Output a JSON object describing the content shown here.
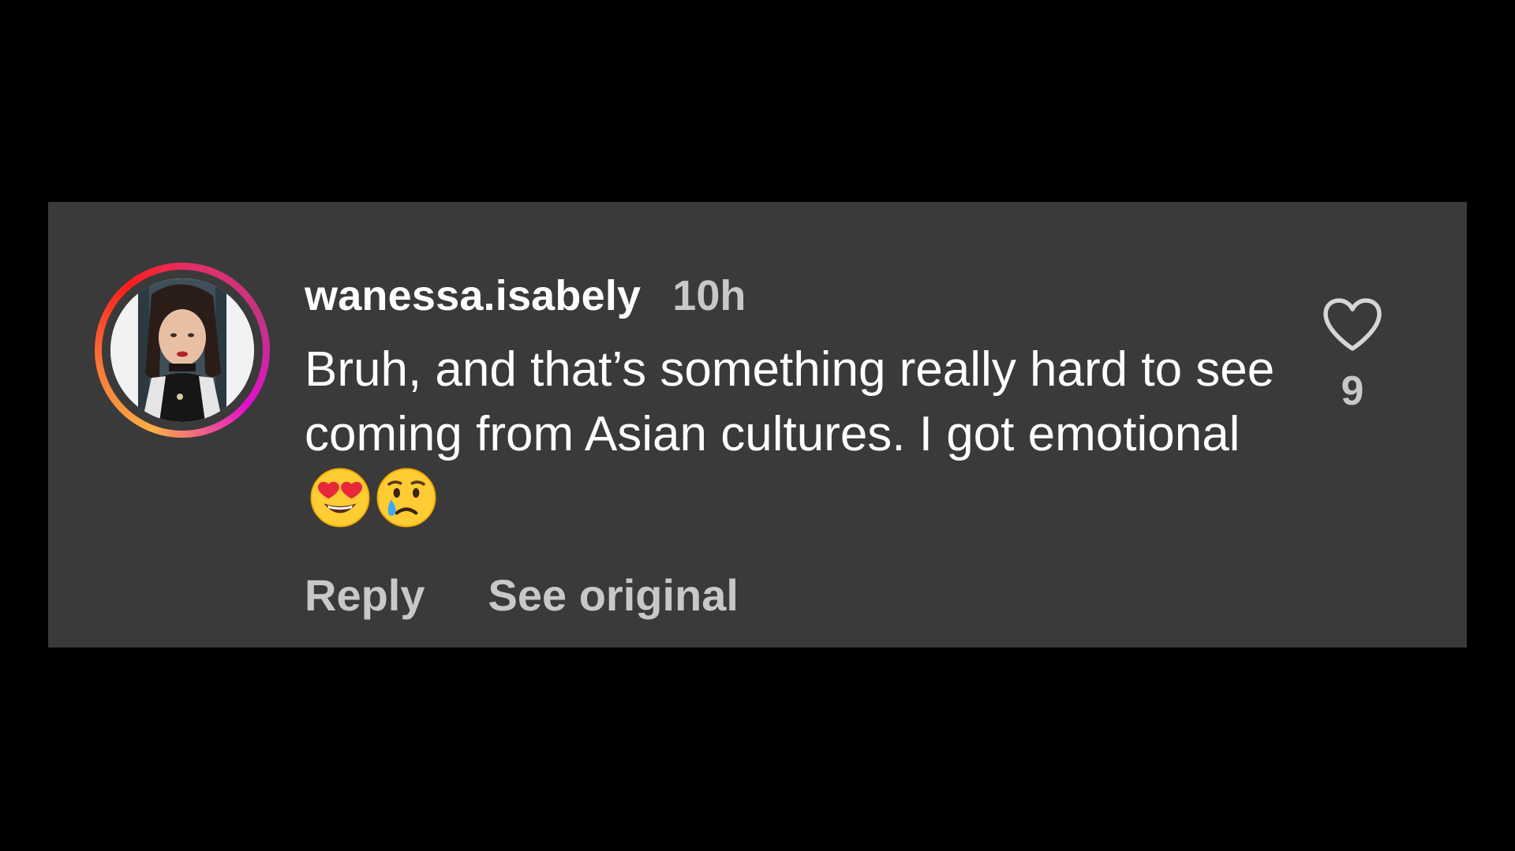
{
  "comment": {
    "username": "wanessa.isabely",
    "timestamp": "10h",
    "text_before_emoji": "Bruh, and that’s something really hard to see coming from Asian cultures. I got emotional ",
    "emojis": [
      "heart-eyes-emoji",
      "crying-face-emoji"
    ],
    "like_count": "9",
    "actions": {
      "reply_label": "Reply",
      "see_original_label": "See original"
    }
  },
  "colors": {
    "page_background": "#000000",
    "card_background": "#3a3a3a",
    "primary_text": "#ffffff",
    "secondary_text": "#c8c8c8"
  },
  "icons": {
    "like": "heart-outline-icon",
    "avatar_ring": "story-ring-gradient"
  }
}
